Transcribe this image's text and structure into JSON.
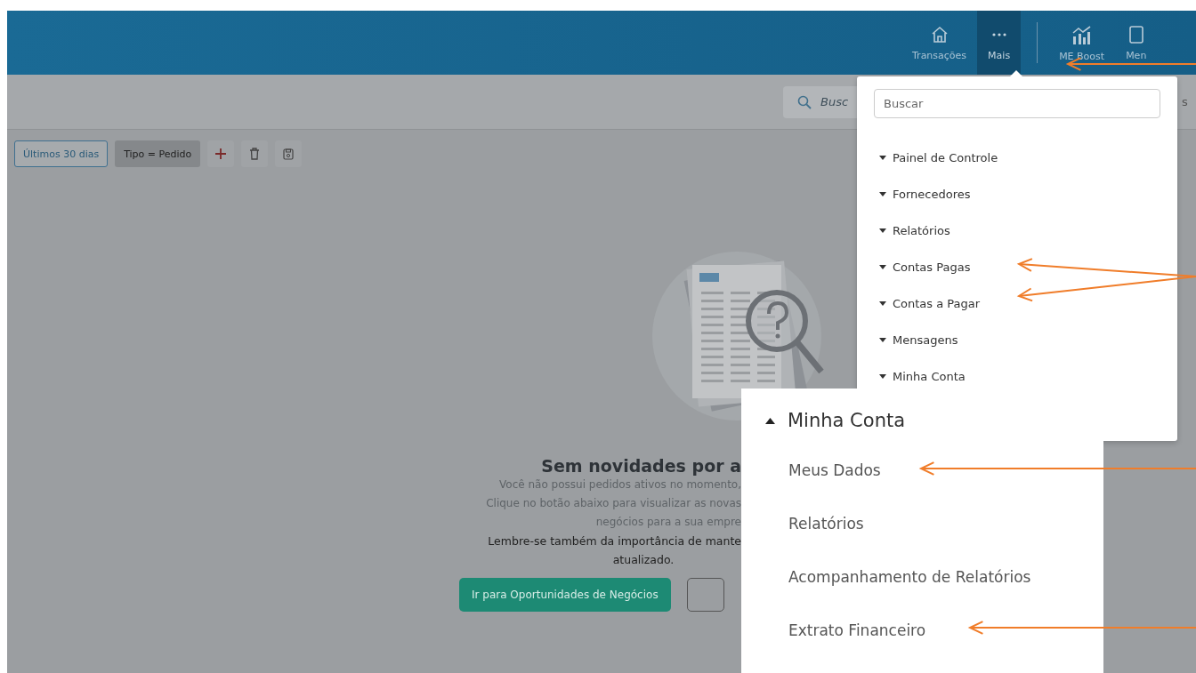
{
  "topbar": {
    "nav": [
      {
        "label": "Transações",
        "selected": false
      },
      {
        "label": "Mais",
        "selected": true
      },
      {
        "label": "ME Boost",
        "selected": false
      },
      {
        "label": "Men",
        "selected": false
      }
    ]
  },
  "search_bar": {
    "placeholder": "Busc",
    "trailing_text": "s"
  },
  "filters": [
    {
      "label": "Últimos 30 dias",
      "kind": "outline"
    },
    {
      "label": "Tipo = Pedido",
      "kind": "filled"
    }
  ],
  "empty_state": {
    "title": "Sem novidades por a",
    "lines": [
      {
        "text": "Você não possui pedidos ativos no momento,",
        "kind": "cut"
      },
      {
        "text": "Clique no botão abaixo para visualizar as novas",
        "kind": "cut"
      },
      {
        "text": "negócios para a sua empre",
        "kind": "cut"
      },
      {
        "text": "Lembre-se também da importância de mante",
        "kind": "cut_dark"
      },
      {
        "text": "atualizado.",
        "kind": "whole_dark"
      }
    ],
    "primary_button": "Ir para Oportunidades de Negócios"
  },
  "dropdown": {
    "search_placeholder": "Buscar",
    "items": [
      {
        "label": "Painel de Controle",
        "expanded": false
      },
      {
        "label": "Fornecedores",
        "expanded": false
      },
      {
        "label": "Relatórios",
        "expanded": false
      },
      {
        "label": "Contas Pagas",
        "expanded": false
      },
      {
        "label": "Contas a Pagar",
        "expanded": false
      },
      {
        "label": "Mensagens",
        "expanded": false
      },
      {
        "label": "Minha Conta",
        "expanded": false
      }
    ]
  },
  "inset": {
    "heading": {
      "label": "Minha Conta",
      "expanded": true
    },
    "children": [
      "Meus Dados",
      "Relatórios",
      "Acompanhamento de Relatórios",
      "Extrato Financeiro"
    ]
  }
}
